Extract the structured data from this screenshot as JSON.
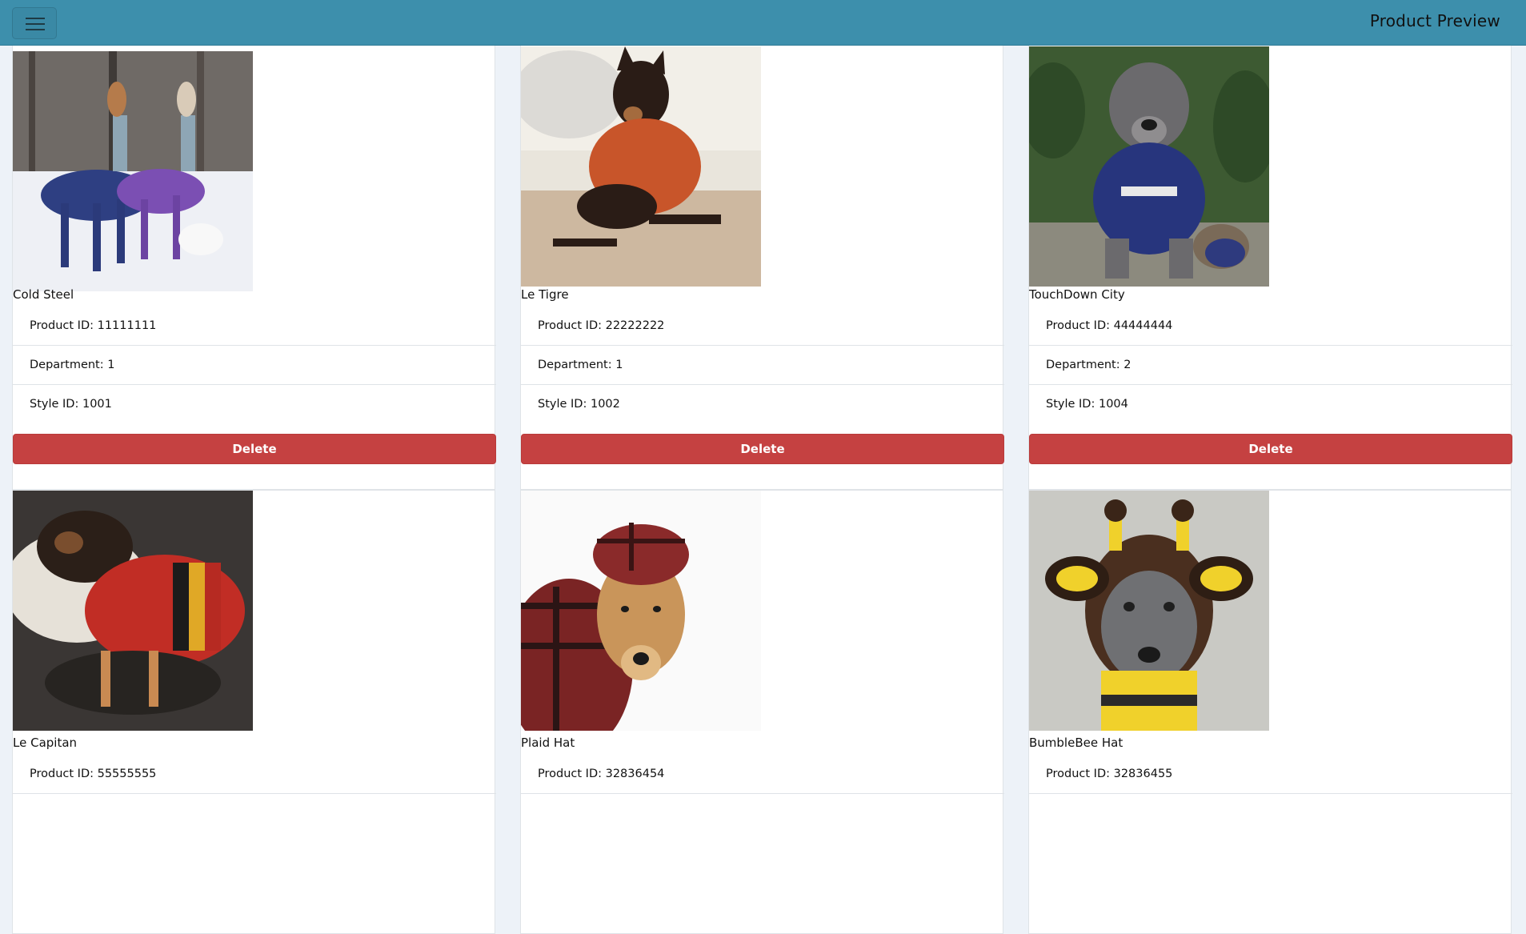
{
  "navbar": {
    "title": "Product Preview",
    "menu_icon": "hamburger-icon"
  },
  "colors": {
    "navbar": "#3d8fac",
    "delete_button": "#c54141",
    "background": "#edf2f8"
  },
  "products": [
    {
      "name": "Cold Steel",
      "product_id": "Product ID: 11111111",
      "department": "Department: 1",
      "style_id": "Style ID: 1001",
      "delete_label": "Delete"
    },
    {
      "name": "Le Tigre",
      "product_id": "Product ID: 22222222",
      "department": "Department: 1",
      "style_id": "Style ID: 1002",
      "delete_label": "Delete"
    },
    {
      "name": "TouchDown City",
      "product_id": "Product ID: 44444444",
      "department": "Department: 2",
      "style_id": "Style ID: 1004",
      "delete_label": "Delete"
    },
    {
      "name": "Le Capitan",
      "product_id": "Product ID: 55555555"
    },
    {
      "name": "Plaid Hat",
      "product_id": "Product ID: 32836454"
    },
    {
      "name": "BumbleBee Hat",
      "product_id": "Product ID: 32836455"
    }
  ]
}
